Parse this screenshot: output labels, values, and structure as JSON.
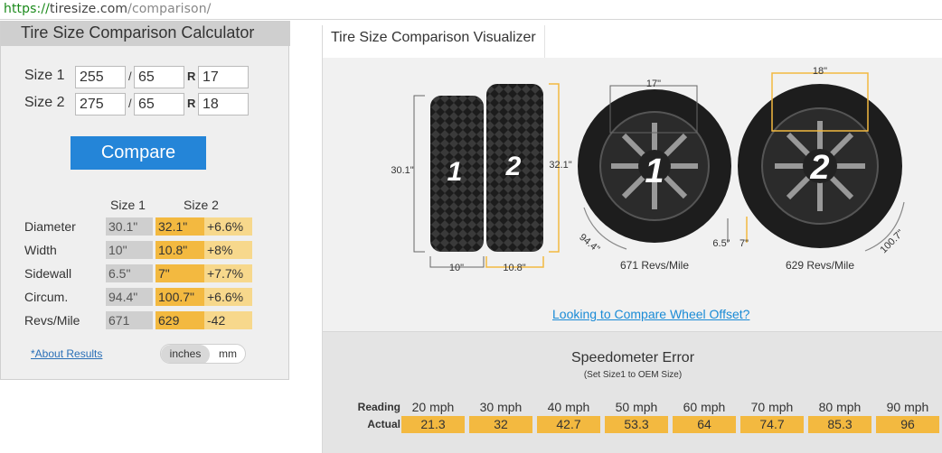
{
  "browser": {
    "url_scheme": "https://",
    "url_host": "tiresize.com",
    "url_path": "/comparison/"
  },
  "calculator": {
    "title": "Tire Size Comparison Calculator",
    "size1": {
      "label": "Size 1",
      "width": "255",
      "aspect": "65",
      "rim": "17"
    },
    "size2": {
      "label": "Size 2",
      "width": "275",
      "aspect": "65",
      "rim": "18"
    },
    "sep": "/",
    "r_label": "R",
    "compare_label": "Compare",
    "results": {
      "col1": "Size 1",
      "col2": "Size 2",
      "rows": [
        {
          "label": "Diameter",
          "v1": "30.1\"",
          "v2": "32.1\"",
          "diff": "+6.6%"
        },
        {
          "label": "Width",
          "v1": "10\"",
          "v2": "10.8\"",
          "diff": "+8%"
        },
        {
          "label": "Sidewall",
          "v1": "6.5\"",
          "v2": "7\"",
          "diff": "+7.7%"
        },
        {
          "label": "Circum.",
          "v1": "94.4\"",
          "v2": "100.7\"",
          "diff": "+6.6%"
        },
        {
          "label": "Revs/Mile",
          "v1": "671",
          "v2": "629",
          "diff": "-42"
        }
      ]
    },
    "about_label": "*About Results",
    "unit_inches": "inches",
    "unit_mm": "mm"
  },
  "visualizer": {
    "tab_label": "Tire Size Comparison Visualizer",
    "tire1_number": "1",
    "tire2_number": "2",
    "side_height1": "30.1\"",
    "side_height2": "32.1\"",
    "side_width1": "10\"",
    "side_width2": "10.8\"",
    "rim1": "17\"",
    "rim2": "18\"",
    "sidewall1": "6.5\"",
    "sidewall2": "7\"",
    "circ1": "94.4\"",
    "circ2": "100.7\"",
    "revs1": "671 Revs/Mile",
    "revs2": "629 Revs/Mile",
    "offset_link": "Looking to Compare Wheel Offset?",
    "accent_color": "#f3b940"
  },
  "speedometer": {
    "title": "Speedometer Error",
    "subtitle": "(Set Size1 to OEM Size)",
    "reading_label": "Reading",
    "actual_label": "Actual",
    "readings": [
      "20 mph",
      "30 mph",
      "40 mph",
      "50 mph",
      "60 mph",
      "70 mph",
      "80 mph",
      "90 mph"
    ],
    "actuals": [
      "21.3",
      "32",
      "42.7",
      "53.3",
      "64",
      "74.7",
      "85.3",
      "96"
    ]
  }
}
